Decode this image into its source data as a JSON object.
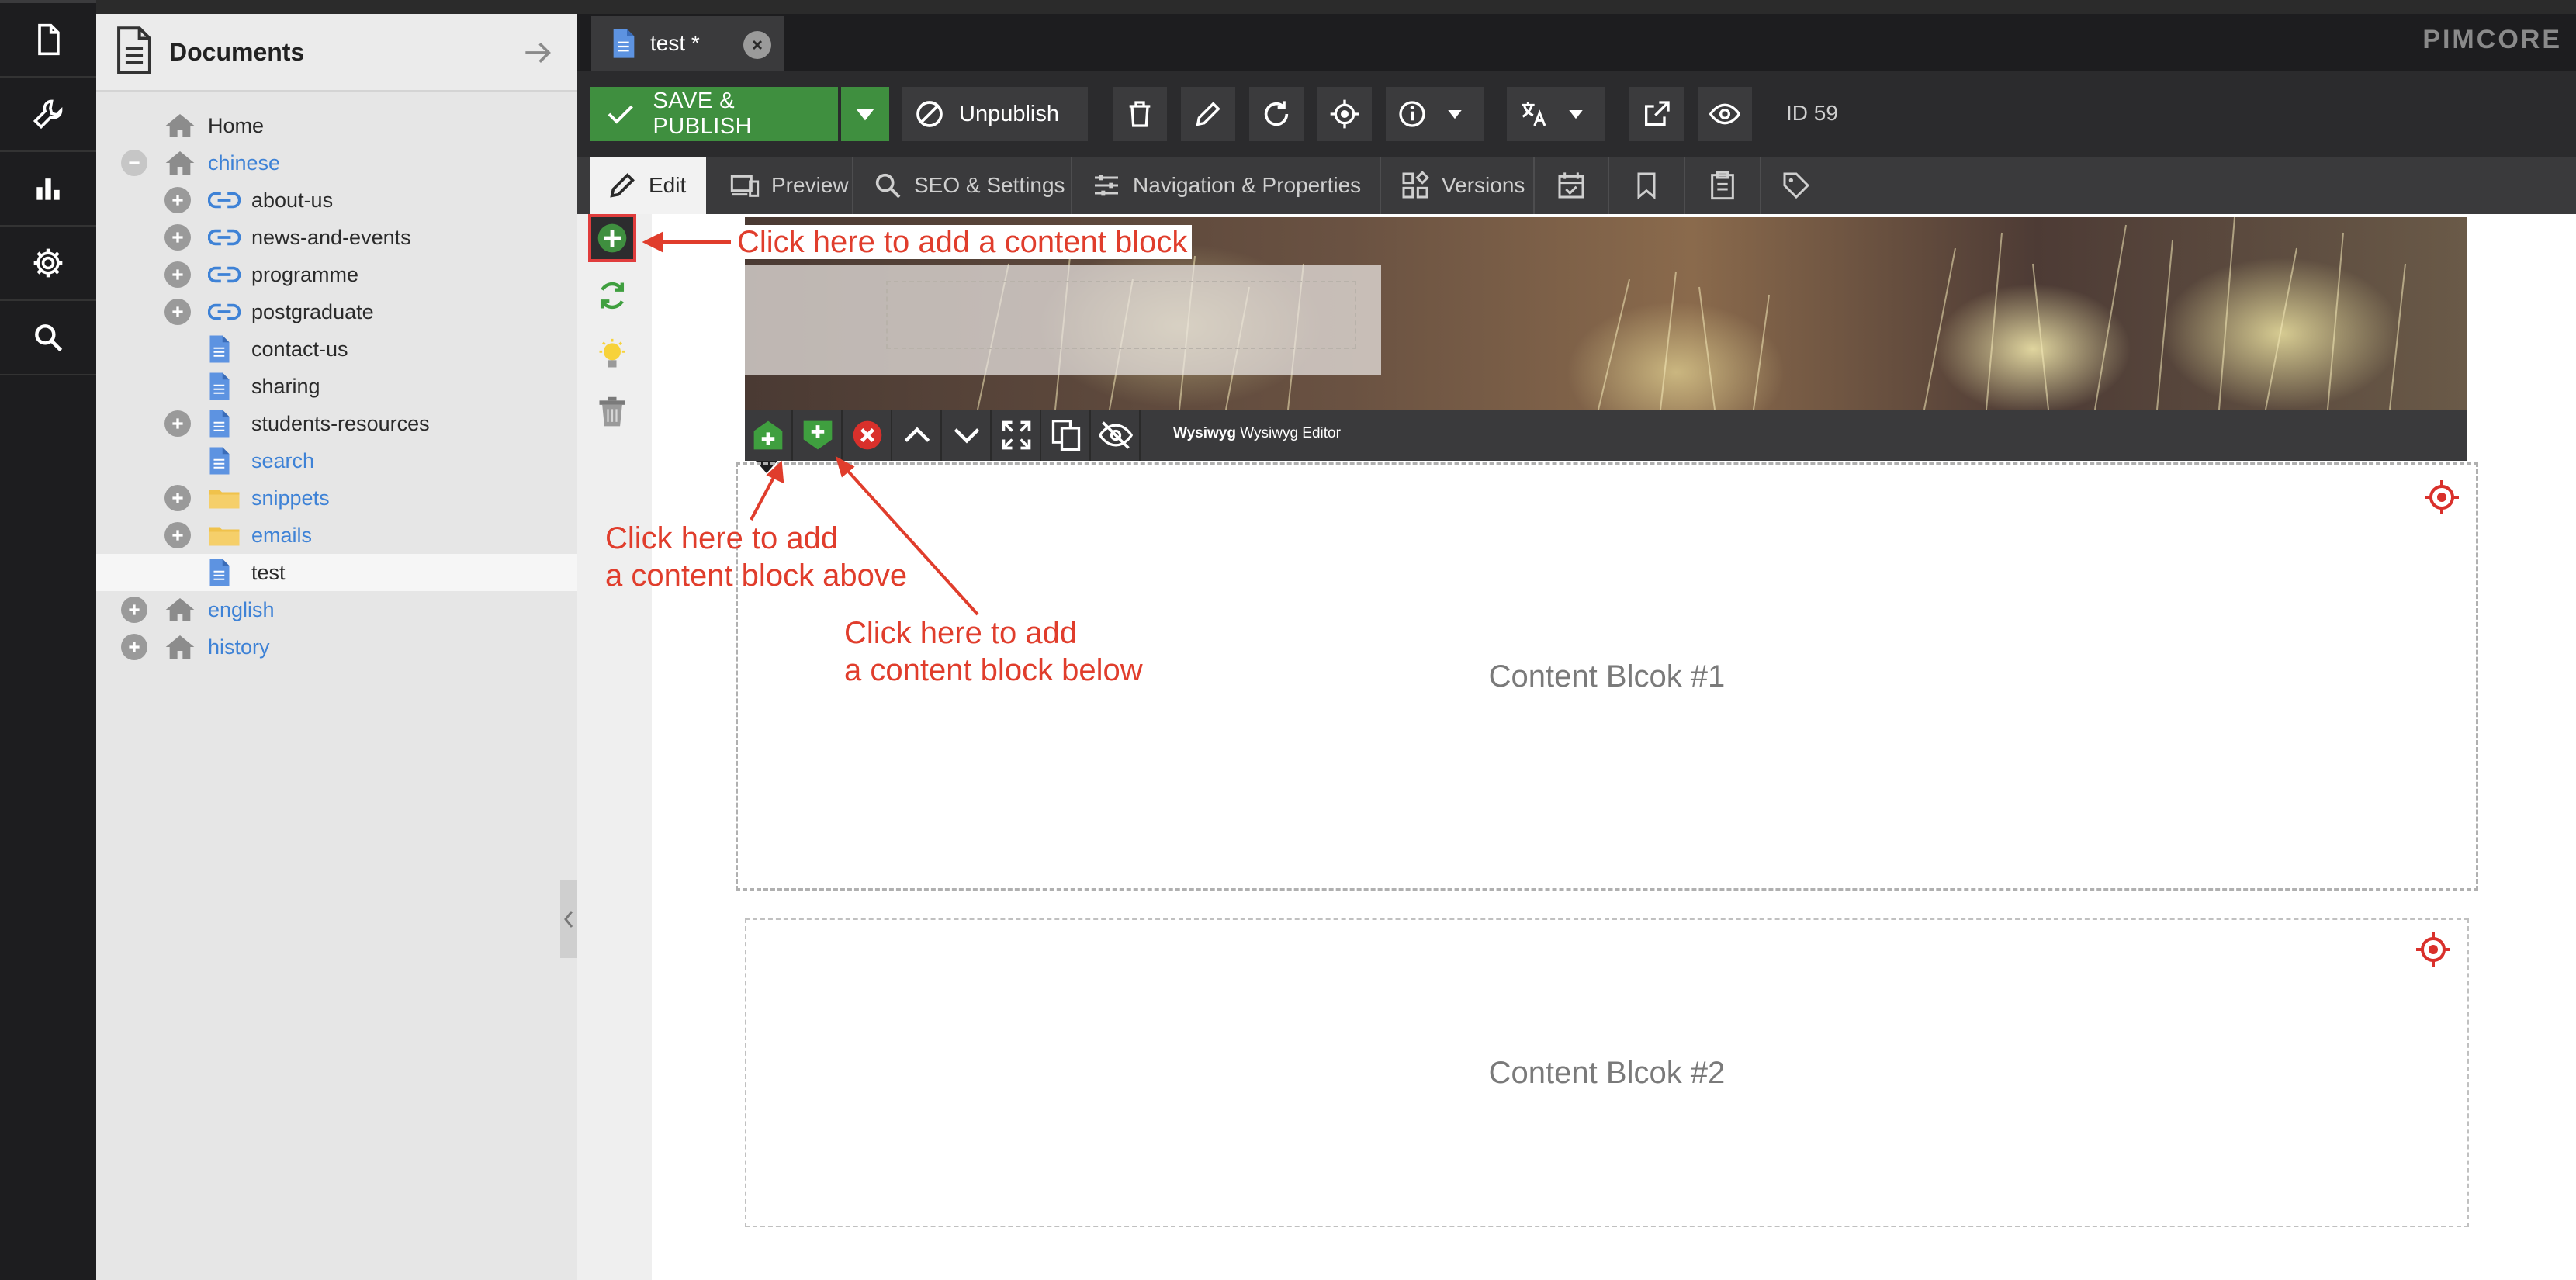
{
  "brand": "PIMCORE",
  "sidebar": {
    "title": "Documents",
    "items": [
      {
        "label": "Home",
        "icon": "home-icon",
        "level": 0,
        "expander": "none",
        "color": "dark"
      },
      {
        "label": "chinese",
        "icon": "home-icon",
        "level": 0,
        "expander": "minus",
        "color": "blue"
      },
      {
        "label": "about-us",
        "icon": "link-icon",
        "level": 1,
        "expander": "plus",
        "color": "dark"
      },
      {
        "label": "news-and-events",
        "icon": "link-icon",
        "level": 1,
        "expander": "plus",
        "color": "dark"
      },
      {
        "label": "programme",
        "icon": "link-icon",
        "level": 1,
        "expander": "plus",
        "color": "dark"
      },
      {
        "label": "postgraduate",
        "icon": "link-icon",
        "level": 1,
        "expander": "plus",
        "color": "dark"
      },
      {
        "label": "contact-us",
        "icon": "document-icon",
        "level": 1,
        "expander": "none",
        "color": "dark"
      },
      {
        "label": "sharing",
        "icon": "document-icon",
        "level": 1,
        "expander": "none",
        "color": "dark"
      },
      {
        "label": "students-resources",
        "icon": "document-icon",
        "level": 1,
        "expander": "plus",
        "color": "dark"
      },
      {
        "label": "search",
        "icon": "document-icon",
        "level": 1,
        "expander": "none",
        "color": "blue"
      },
      {
        "label": "snippets",
        "icon": "folder-icon",
        "level": 1,
        "expander": "plus",
        "color": "blue"
      },
      {
        "label": "emails",
        "icon": "folder-icon",
        "level": 1,
        "expander": "plus",
        "color": "blue"
      },
      {
        "label": "test",
        "icon": "document-icon",
        "level": 1,
        "expander": "none",
        "color": "dark",
        "selected": true
      },
      {
        "label": "english",
        "icon": "home-icon",
        "level": 0,
        "expander": "plus",
        "color": "blue"
      },
      {
        "label": "history",
        "icon": "home-icon",
        "level": 0,
        "expander": "plus",
        "color": "blue"
      }
    ]
  },
  "tab": {
    "label": "test *"
  },
  "toolbar": {
    "save_publish": "SAVE & PUBLISH",
    "unpublish": "Unpublish",
    "id_label": "ID 59"
  },
  "subtabs": {
    "edit": "Edit",
    "preview": "Preview",
    "seo": "SEO & Settings",
    "navigation": "Navigation & Properties",
    "versions": "Versions"
  },
  "editable": {
    "type_bold": "Wysiwyg",
    "type_name": "Wysiwyg Editor"
  },
  "blocks": {
    "block1": "Content Blcok #1",
    "block2": "Content Blcok #2"
  },
  "annotations": {
    "add_block": "Click here to add a content block",
    "add_above_1": "Click here to add",
    "add_above_2": "a content block above",
    "add_below_1": "Click here to add",
    "add_below_2": "a content block below"
  },
  "colors": {
    "accent_green": "#3f8f3f",
    "annotation_red": "#e03d2c",
    "link_blue": "#3e82d6"
  }
}
